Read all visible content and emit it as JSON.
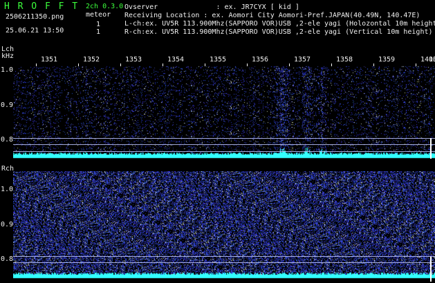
{
  "header": {
    "app_title": "H R O F F T",
    "channel_mode": "2ch 0.3.0",
    "meteor_label": "meteor",
    "filename": "2506211350.png",
    "datetime": "25.06.21 13:50",
    "meteor_count_1": "1",
    "meteor_count_2": "1",
    "observer_line": "Ovserver              : ex. JR7CYX [ kid ]",
    "location_line": "Receiving Location : ex. Aomori City Aomori-Pref.JAPAN(40.49N, 140.47E)",
    "lch_line": "L-ch:ex. UV5R 113.900Mhz(SAPPORO VOR)USB ,2-ele yagi (Holozontal 10m height)",
    "rch_line": "R-ch:ex. UV5R 113.900Mhz(SAPPORO VOR)USB ,2-ele yagi (Vertical 10m height)"
  },
  "lch_panel": {
    "label": "Lch",
    "unit": "kHz",
    "time_ticks": [
      "1351",
      "1352",
      "1353",
      "1354",
      "1355",
      "1356",
      "1357",
      "1358",
      "1359",
      "1400"
    ],
    "end_tick": "13",
    "freq_ticks": [
      "1.0",
      "0.9",
      "0.8"
    ]
  },
  "rch_panel": {
    "label": "Rch",
    "freq_ticks": [
      "1.0",
      "0.9",
      "0.8"
    ]
  },
  "colors": {
    "header_green": "#3cff3c",
    "signal_cyan": "#33ffff",
    "noise_blue": "#1a2aa0",
    "background": "#000000"
  }
}
